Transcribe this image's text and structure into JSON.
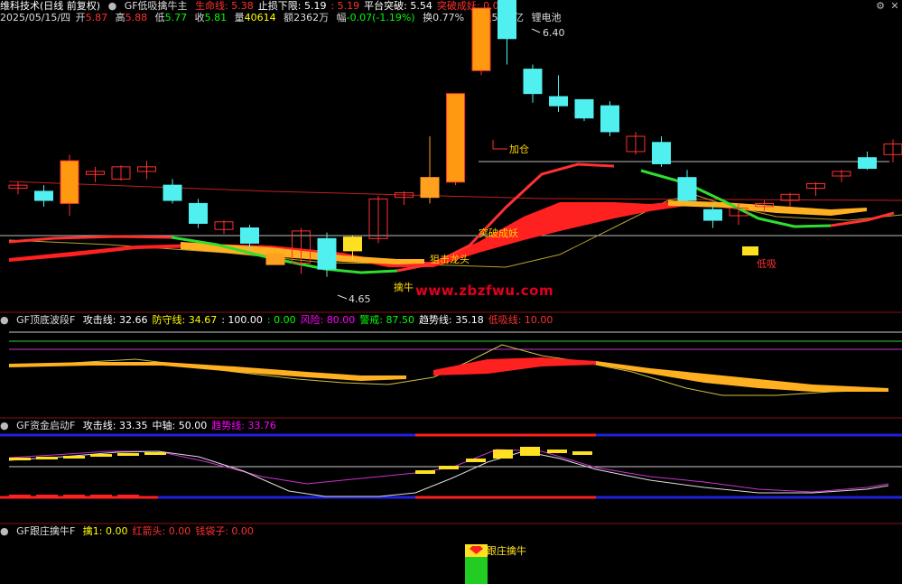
{
  "header": {
    "stock_name": "维科技术(日线 前复权)",
    "indicator": "GF低吸擒牛主",
    "items": [
      {
        "label": "生命线",
        "value": "5.38",
        "color": "#ff3030"
      },
      {
        "label": "止损下限",
        "value": "5.19",
        "color": "#ffffff"
      },
      {
        "label": "",
        "value": "5.19",
        "color": "#ff3030"
      },
      {
        "label": "平台突破",
        "value": "5.54",
        "color": "#ffffff"
      },
      {
        "label": "突破成妖",
        "value": "0.00",
        "color": "#ff3030"
      }
    ]
  },
  "quote": {
    "date": "2025/05/15/四",
    "open_label": "开",
    "open": "5.87",
    "high_label": "高",
    "high": "5.88",
    "low_label": "低",
    "low": "5.77",
    "close_label": "收",
    "close": "5.81",
    "vol_label": "量",
    "vol": "40614",
    "amt_label": "额",
    "amt": "2362万",
    "chg_label": "幅",
    "chg": "-0.07(-1.19%)",
    "turn_label": "换",
    "turn": "0.77%",
    "float_label": "流通",
    "float": "5.29亿",
    "sector": "锂电池"
  },
  "price_annotations": {
    "high_mark": "6.40",
    "low_mark": "4.65",
    "add": "加仓",
    "breakout": "突破成妖",
    "dragon": "狙击龙头",
    "catch": "擒牛",
    "lowbuy": "低吸"
  },
  "panel2": {
    "title": "GF顶底波段F",
    "items": [
      {
        "label": "攻击线",
        "value": "32.66",
        "color": "#ffffff"
      },
      {
        "label": "防守线",
        "value": "34.67",
        "color": "#ffff00"
      },
      {
        "label": "",
        "value": "100.00",
        "color": "#ffffff"
      },
      {
        "label": "",
        "value": "0.00",
        "color": "#00ff00"
      },
      {
        "label": "风险",
        "value": "80.00",
        "color": "#ff00ff"
      },
      {
        "label": "警戒",
        "value": "87.50",
        "color": "#00ff00"
      },
      {
        "label": "趋势线",
        "value": "35.18",
        "color": "#ffffff"
      },
      {
        "label": "低吸线",
        "value": "10.00",
        "color": "#ff3030"
      }
    ]
  },
  "panel3": {
    "title": "GF资金启动F",
    "items": [
      {
        "label": "攻击线",
        "value": "33.35",
        "color": "#ffffff"
      },
      {
        "label": "中轴",
        "value": "50.00",
        "color": "#ffffff"
      },
      {
        "label": "趋势线",
        "value": "33.76",
        "color": "#ff00ff"
      }
    ]
  },
  "panel4": {
    "title": "GF跟庄擒牛F",
    "items": [
      {
        "label": "擒1",
        "value": "0.00",
        "color": "#ffff00"
      },
      {
        "label": "红箭头",
        "value": "0.00",
        "color": "#ff3030"
      },
      {
        "label": "钱袋子",
        "value": "0.00",
        "color": "#ff3030"
      }
    ],
    "signal": "跟庄擒牛"
  },
  "watermark": "www.zbzfwu.com",
  "chart_data": {
    "type": "candlestick",
    "note_series": [
      "生命线",
      "止损下限",
      "平台突破"
    ],
    "candles": [
      {
        "o": 5.38,
        "h": 5.42,
        "l": 5.34,
        "c": 5.4
      },
      {
        "o": 5.36,
        "h": 5.4,
        "l": 5.26,
        "c": 5.3
      },
      {
        "o": 5.28,
        "h": 5.6,
        "l": 5.2,
        "c": 5.56
      },
      {
        "o": 5.47,
        "h": 5.52,
        "l": 5.42,
        "c": 5.49
      },
      {
        "o": 5.44,
        "h": 5.53,
        "l": 5.43,
        "c": 5.52
      },
      {
        "o": 5.49,
        "h": 5.56,
        "l": 5.44,
        "c": 5.52
      },
      {
        "o": 5.4,
        "h": 5.44,
        "l": 5.28,
        "c": 5.3
      },
      {
        "o": 5.28,
        "h": 5.31,
        "l": 5.12,
        "c": 5.15
      },
      {
        "o": 5.11,
        "h": 5.17,
        "l": 5.08,
        "c": 5.16
      },
      {
        "o": 5.12,
        "h": 5.14,
        "l": 4.98,
        "c": 5.02
      },
      {
        "o": 4.95,
        "h": 4.99,
        "l": 4.88,
        "c": 4.88
      },
      {
        "o": 4.89,
        "h": 5.12,
        "l": 4.82,
        "c": 5.1
      },
      {
        "o": 5.05,
        "h": 5.09,
        "l": 4.8,
        "c": 4.85
      },
      {
        "o": 4.97,
        "h": 5.07,
        "l": 4.91,
        "c": 5.06
      },
      {
        "o": 5.05,
        "h": 5.33,
        "l": 5.02,
        "c": 5.31
      },
      {
        "o": 5.32,
        "h": 5.36,
        "l": 5.27,
        "c": 5.35
      },
      {
        "o": 5.32,
        "h": 5.72,
        "l": 5.28,
        "c": 5.45
      },
      {
        "o": 5.42,
        "h": 6.0,
        "l": 5.4,
        "c": 6.0
      },
      {
        "o": 6.15,
        "h": 6.54,
        "l": 6.12,
        "c": 6.56
      },
      {
        "o": 6.64,
        "h": 6.45,
        "l": 6.19,
        "c": 6.36
      },
      {
        "o": 6.16,
        "h": 6.19,
        "l": 5.94,
        "c": 6.0
      },
      {
        "o": 5.98,
        "h": 6.12,
        "l": 5.88,
        "c": 5.92
      },
      {
        "o": 5.96,
        "h": 5.95,
        "l": 5.82,
        "c": 5.84
      },
      {
        "o": 5.92,
        "h": 5.95,
        "l": 5.72,
        "c": 5.75
      },
      {
        "o": 5.62,
        "h": 5.75,
        "l": 5.6,
        "c": 5.72
      },
      {
        "o": 5.68,
        "h": 5.72,
        "l": 5.52,
        "c": 5.54
      },
      {
        "o": 5.45,
        "h": 5.5,
        "l": 5.29,
        "c": 5.3
      },
      {
        "o": 5.24,
        "h": 5.27,
        "l": 5.12,
        "c": 5.17
      },
      {
        "o": 5.2,
        "h": 5.28,
        "l": 5.14,
        "c": 5.25
      },
      {
        "o": 5.26,
        "h": 5.3,
        "l": 5.22,
        "c": 5.28
      },
      {
        "o": 5.3,
        "h": 5.35,
        "l": 5.26,
        "c": 5.34
      },
      {
        "o": 5.38,
        "h": 5.42,
        "l": 5.33,
        "c": 5.41
      },
      {
        "o": 5.46,
        "h": 5.5,
        "l": 5.42,
        "c": 5.49
      },
      {
        "o": 5.58,
        "h": 5.62,
        "l": 5.5,
        "c": 5.51
      },
      {
        "o": 5.6,
        "h": 5.7,
        "l": 5.55,
        "c": 5.67
      }
    ]
  }
}
